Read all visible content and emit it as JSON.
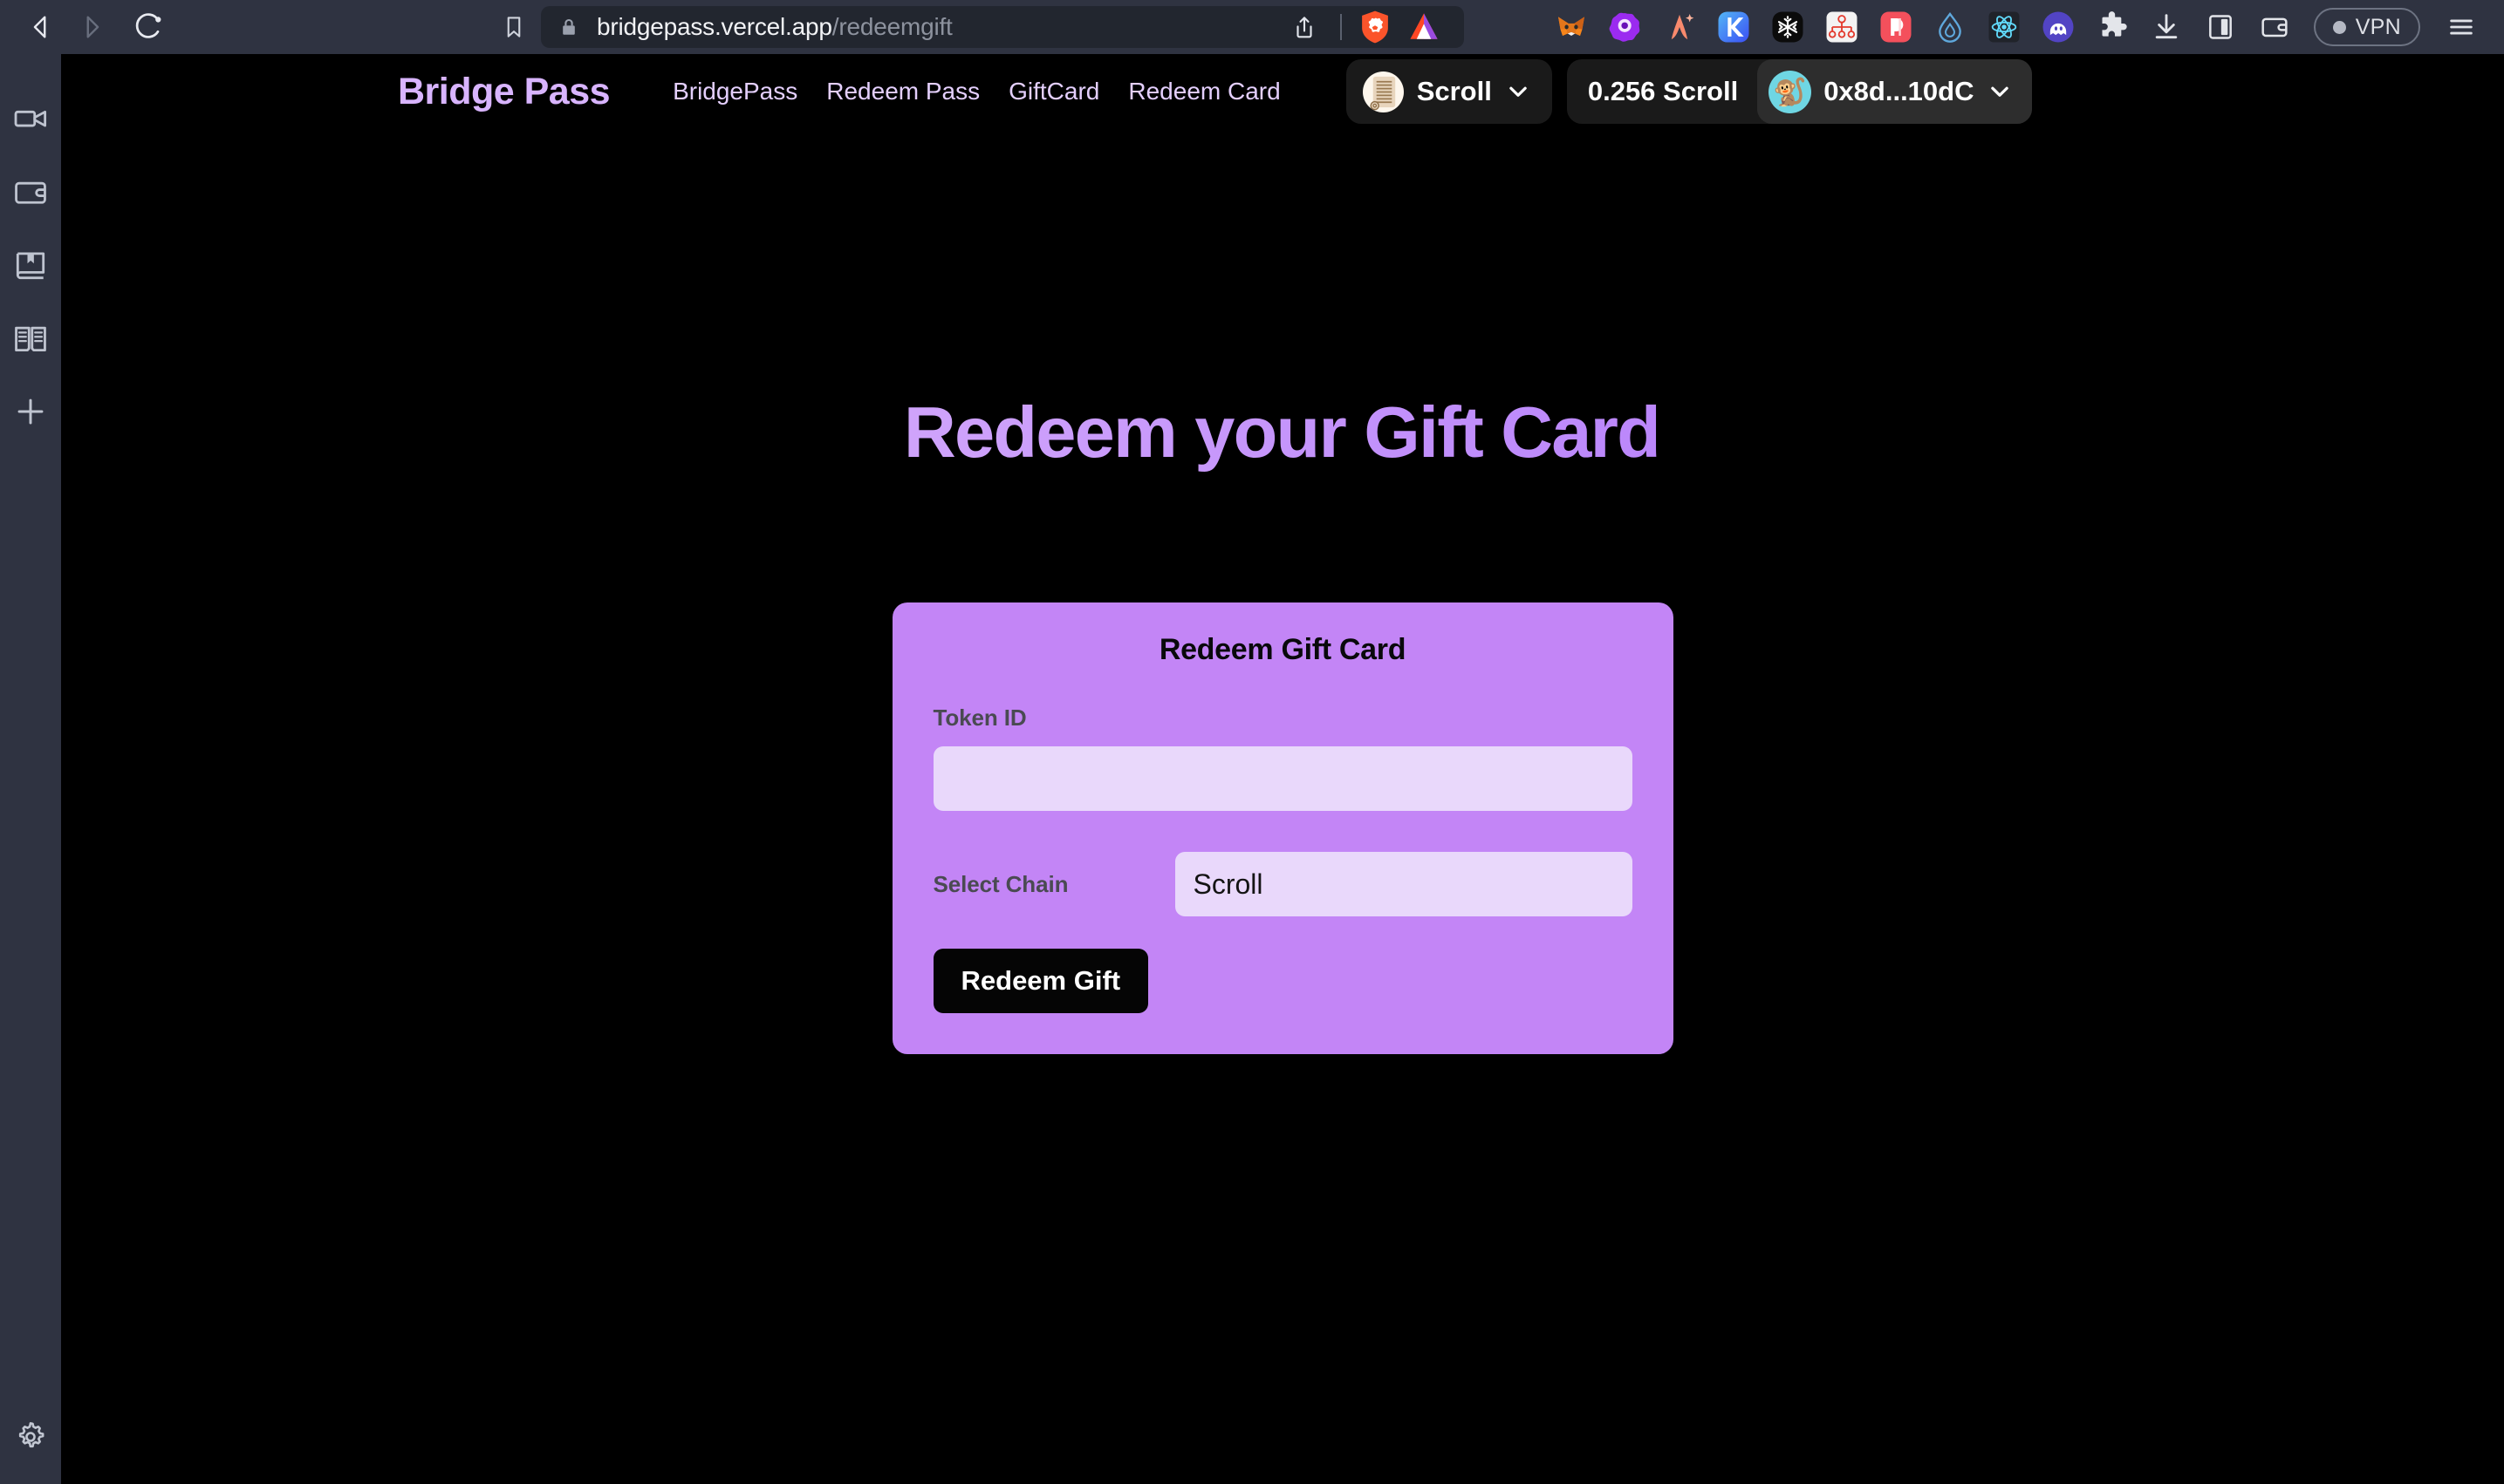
{
  "browser": {
    "nav": {
      "back_icon": "back-arrow-icon",
      "forward_icon": "forward-arrow-icon",
      "reload_icon": "reload-icon",
      "bookmark_icon": "bookmark-icon"
    },
    "urlbar": {
      "lock_icon": "lock-icon",
      "domain": "bridgepass.vercel.app",
      "path": "/redeemgift",
      "share_icon": "share-icon",
      "shield_icon": "brave-shield-lion-icon",
      "rewards_icon": "bat-triangle-icon"
    },
    "extensions": [
      {
        "name": "metamask-extension-icon",
        "label": "MetaMask"
      },
      {
        "name": "purple-eye-extension-icon",
        "label": "Eye"
      },
      {
        "name": "coral-a-extension-icon",
        "label": "A"
      },
      {
        "name": "keplr-extension-icon",
        "label": "K"
      },
      {
        "name": "snowflake-extension-icon",
        "label": "Snowflake"
      },
      {
        "name": "red-tree-extension-icon",
        "label": "Tree"
      },
      {
        "name": "pink-p-extension-icon",
        "label": "P"
      },
      {
        "name": "water-droplet-extension-icon",
        "label": "Droplet"
      },
      {
        "name": "react-devtools-extension-icon",
        "label": "React"
      },
      {
        "name": "phantom-ghost-extension-icon",
        "label": "Phantom"
      },
      {
        "name": "puzzle-extensions-icon",
        "label": "Extensions"
      },
      {
        "name": "download-icon",
        "label": "Downloads"
      },
      {
        "name": "sidebar-toggle-icon",
        "label": "Sidebar"
      },
      {
        "name": "wallet-icon",
        "label": "Wallet"
      }
    ],
    "vpn": {
      "label": "VPN",
      "status_color": "#b5b9c4"
    },
    "menu_icon": "hamburger-menu-icon"
  },
  "sidebar": {
    "items": [
      {
        "name": "sidebar-item-video",
        "icon": "video-camera-icon"
      },
      {
        "name": "sidebar-item-wallet",
        "icon": "wallet-icon"
      },
      {
        "name": "sidebar-item-bookmarks",
        "icon": "bookmarked-book-icon"
      },
      {
        "name": "sidebar-item-reading",
        "icon": "open-book-icon"
      },
      {
        "name": "sidebar-item-add",
        "icon": "plus-icon"
      }
    ],
    "settings": {
      "name": "sidebar-item-settings",
      "icon": "gear-icon"
    }
  },
  "site": {
    "brand": "Bridge Pass",
    "nav_links": [
      "BridgePass",
      "Redeem Pass",
      "GiftCard",
      "Redeem Card"
    ],
    "chain_selector": {
      "label": "Scroll",
      "logo_icon": "scroll-chain-logo-icon",
      "chevron_icon": "chevron-down-icon"
    },
    "wallet": {
      "balance": "0.256 Scroll",
      "address": "0x8d...10dC",
      "avatar_icon": "monkey-avatar-icon",
      "avatar_glyph": "🐒",
      "avatar_bg": "#6fd6e3",
      "chevron_icon": "chevron-down-icon"
    }
  },
  "main": {
    "hero_title": "Redeem your Gift Card",
    "card": {
      "title": "Redeem Gift Card",
      "token_id_label": "Token ID",
      "token_id_value": "",
      "token_id_placeholder": "",
      "select_chain_label": "Select Chain",
      "selected_chain": "Scroll",
      "chain_options": [
        "Scroll"
      ],
      "submit_label": "Redeem Gift"
    }
  },
  "colors": {
    "page_bg": "#000000",
    "brand_purple": "#d8b4fe",
    "card_bg": "#c385f6",
    "input_bg": "#e9d8fb",
    "button_bg": "#050505",
    "chrome_bg": "#2f3341",
    "urlbar_bg": "#22262f"
  }
}
